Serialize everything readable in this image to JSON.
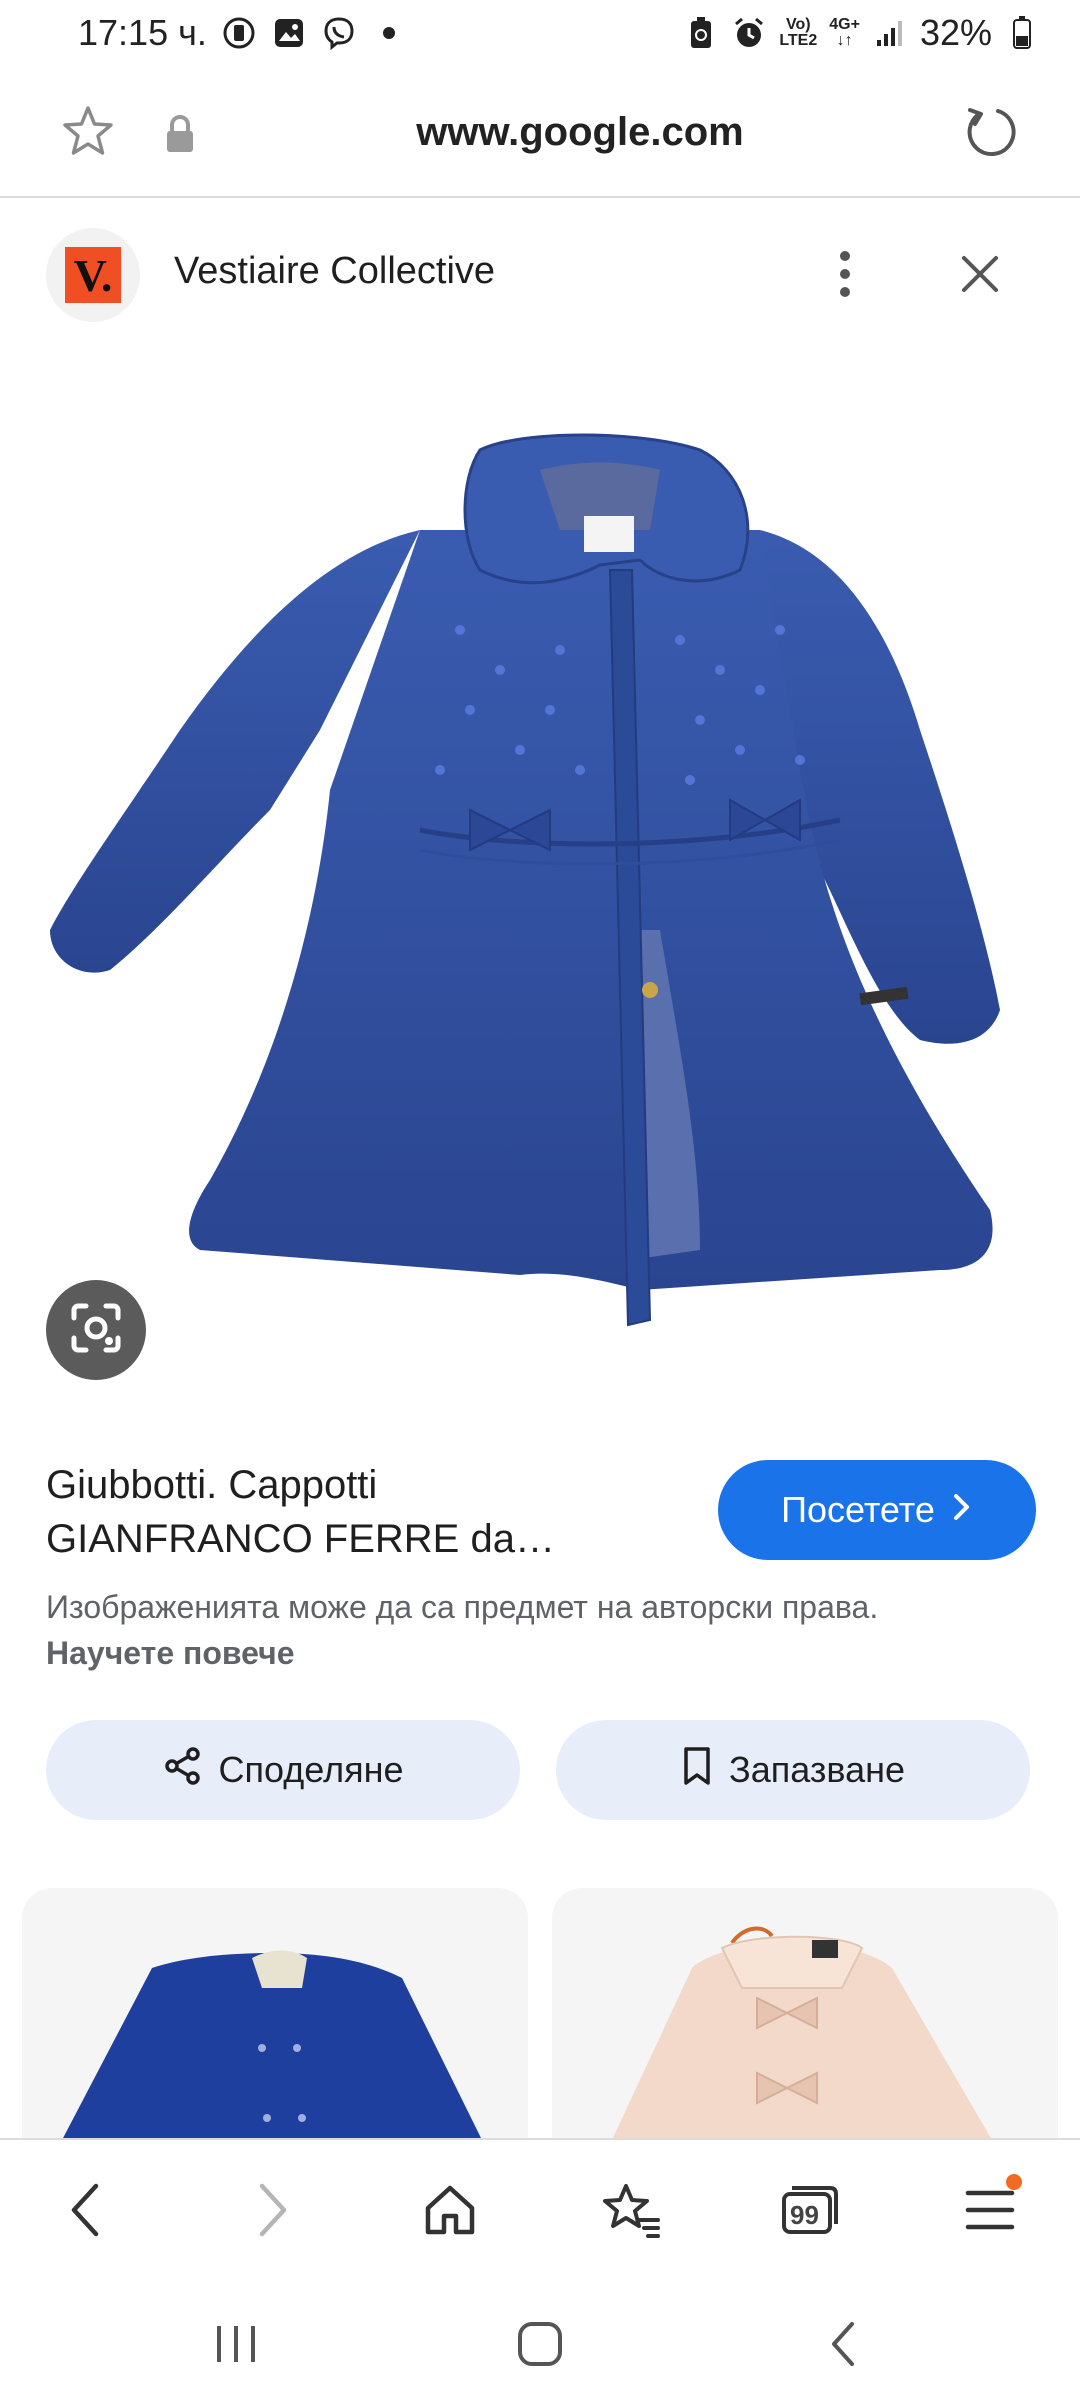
{
  "status_bar": {
    "time": "17:15 ч.",
    "network_top": "Vo)",
    "network_bottom": "LTE2",
    "signal_type": "4G+",
    "battery": "32%"
  },
  "url_bar": {
    "url": "www.google.com"
  },
  "source": {
    "logo_letter": "V.",
    "name": "Vestiaire Collective"
  },
  "result": {
    "title_line1": "Giubbotti. Cappotti",
    "title_line2": "GIANFRANCO FERRE da…",
    "visit_label": "Посетете",
    "copyright_text": "Изображенията може да са предмет на авторски права. ",
    "learn_more": "Научете повече"
  },
  "actions": {
    "share_label": "Споделяне",
    "save_label": "Запазване"
  },
  "toolbar": {
    "tabs_count": "99"
  },
  "colors": {
    "accent_blue": "#1a73e8",
    "coat_blue": "#2f4f9e",
    "button_bg": "#e8eef9",
    "notification_dot": "#f26a21",
    "logo_orange": "#f04e23"
  },
  "icons": [
    "star-icon",
    "lock-icon",
    "reload-icon",
    "more-vert-icon",
    "close-icon",
    "lens-icon",
    "chevron-right-icon",
    "share-icon",
    "bookmark-icon",
    "back-icon",
    "forward-icon",
    "home-icon",
    "bookmarks-icon",
    "tabs-icon",
    "menu-icon"
  ]
}
